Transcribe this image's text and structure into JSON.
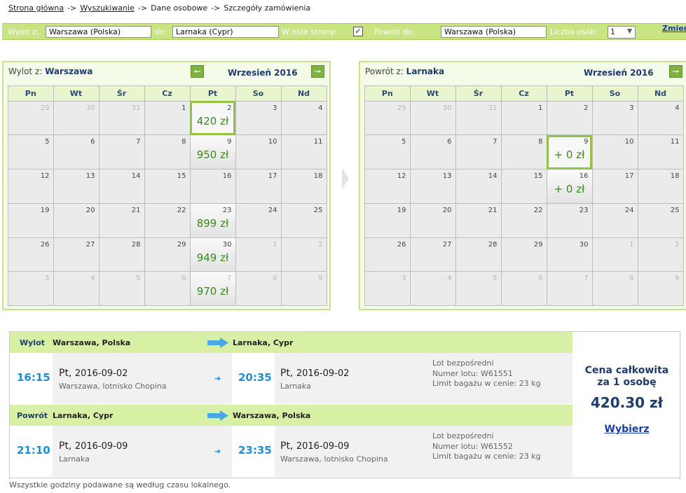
{
  "breadcrumb": [
    {
      "label": "Strona główna",
      "link": true
    },
    {
      "label": "Wyszukiwanie",
      "link": true
    },
    {
      "label": "Dane osobowe",
      "link": false
    },
    {
      "label": "Szczegóły zamówienia",
      "link": false
    }
  ],
  "breadcrumb_sep": "->",
  "search": {
    "from_label": "Wylot z:",
    "from_value": "Warszawa (Polska)",
    "to_label": "do:",
    "to_value": "Larnaka (Cypr)",
    "roundtrip_label": "W obie strony:",
    "roundtrip_checked": "✓",
    "return_label": "Powrót do:",
    "return_value": "Warszawa (Polska)",
    "pax_label": "Liczba osób:",
    "pax_value": "1",
    "change_label": "Zmień"
  },
  "weekdays": [
    "Pn",
    "Wt",
    "Śr",
    "Cz",
    "Pt",
    "So",
    "Nd"
  ],
  "outbound": {
    "title_prefix": "Wylot z:",
    "title_city": "Warszawa",
    "month": "Wrzesień 2016",
    "weeks": [
      [
        {
          "d": "29",
          "o": 1
        },
        {
          "d": "30",
          "o": 1
        },
        {
          "d": "31",
          "o": 1
        },
        {
          "d": "1"
        },
        {
          "d": "2",
          "p": "420 zł",
          "sel": 1
        },
        {
          "d": "3"
        },
        {
          "d": "4"
        }
      ],
      [
        {
          "d": "5"
        },
        {
          "d": "6"
        },
        {
          "d": "7"
        },
        {
          "d": "8"
        },
        {
          "d": "9",
          "p": "950 zł"
        },
        {
          "d": "10"
        },
        {
          "d": "11"
        }
      ],
      [
        {
          "d": "12"
        },
        {
          "d": "13"
        },
        {
          "d": "14"
        },
        {
          "d": "15"
        },
        {
          "d": "16"
        },
        {
          "d": "17"
        },
        {
          "d": "18"
        }
      ],
      [
        {
          "d": "19"
        },
        {
          "d": "20"
        },
        {
          "d": "21"
        },
        {
          "d": "22"
        },
        {
          "d": "23",
          "p": "899 zł"
        },
        {
          "d": "24"
        },
        {
          "d": "25"
        }
      ],
      [
        {
          "d": "26"
        },
        {
          "d": "27"
        },
        {
          "d": "28"
        },
        {
          "d": "29"
        },
        {
          "d": "30",
          "p": "949 zł"
        },
        {
          "d": "1",
          "o": 1
        },
        {
          "d": "2",
          "o": 1
        }
      ],
      [
        {
          "d": "3",
          "o": 1
        },
        {
          "d": "4",
          "o": 1
        },
        {
          "d": "5",
          "o": 1
        },
        {
          "d": "6",
          "o": 1
        },
        {
          "d": "7",
          "o": 1,
          "p": "970 zł"
        },
        {
          "d": "8",
          "o": 1
        },
        {
          "d": "9",
          "o": 1
        }
      ]
    ]
  },
  "inbound": {
    "title_prefix": "Powrót z:",
    "title_city": "Larnaka",
    "month": "Wrzesień 2016",
    "weeks": [
      [
        {
          "d": "29",
          "o": 1
        },
        {
          "d": "30",
          "o": 1
        },
        {
          "d": "31",
          "o": 1
        },
        {
          "d": "1"
        },
        {
          "d": "2"
        },
        {
          "d": "3"
        },
        {
          "d": "4"
        }
      ],
      [
        {
          "d": "5"
        },
        {
          "d": "6"
        },
        {
          "d": "7"
        },
        {
          "d": "8"
        },
        {
          "d": "9",
          "p": "+ 0 zł",
          "sel": 1
        },
        {
          "d": "10"
        },
        {
          "d": "11"
        }
      ],
      [
        {
          "d": "12"
        },
        {
          "d": "13"
        },
        {
          "d": "14"
        },
        {
          "d": "15"
        },
        {
          "d": "16",
          "p": "+ 0 zł"
        },
        {
          "d": "17"
        },
        {
          "d": "18"
        }
      ],
      [
        {
          "d": "19"
        },
        {
          "d": "20"
        },
        {
          "d": "21"
        },
        {
          "d": "22"
        },
        {
          "d": "23"
        },
        {
          "d": "24"
        },
        {
          "d": "25"
        }
      ],
      [
        {
          "d": "26"
        },
        {
          "d": "27"
        },
        {
          "d": "28"
        },
        {
          "d": "29"
        },
        {
          "d": "30"
        },
        {
          "d": "1",
          "o": 1
        },
        {
          "d": "2",
          "o": 1
        }
      ],
      [
        {
          "d": "3",
          "o": 1
        },
        {
          "d": "4",
          "o": 1
        },
        {
          "d": "5",
          "o": 1
        },
        {
          "d": "6",
          "o": 1
        },
        {
          "d": "7",
          "o": 1
        },
        {
          "d": "8",
          "o": 1
        },
        {
          "d": "9",
          "o": 1
        }
      ]
    ]
  },
  "summary": {
    "outbound": {
      "label": "Wylot",
      "from": "Warszawa, Polska",
      "to": "Larnaka, Cypr",
      "dep_time": "16:15",
      "dep_day": "Pt,",
      "dep_date": "2016-09-02",
      "dep_airport": "Warszawa, lotnisko Chopina",
      "arr_time": "20:35",
      "arr_day": "Pt,",
      "arr_date": "2016-09-02",
      "arr_airport": "Larnaka",
      "info1": "Lot bezpośredni",
      "info2": "Numer lotu: W61551",
      "info3": "Limit bagażu w cenie: 23 kg"
    },
    "inbound": {
      "label": "Powrót",
      "from": "Larnaka, Cypr",
      "to": "Warszawa, Polska",
      "dep_time": "21:10",
      "dep_day": "Pt,",
      "dep_date": "2016-09-09",
      "dep_airport": "Larnaka",
      "arr_time": "23:35",
      "arr_day": "Pt,",
      "arr_date": "2016-09-09",
      "arr_airport": "Warszawa, lotnisko Chopina",
      "info1": "Lot bezpośredni",
      "info2": "Numer lotu: W61552",
      "info3": "Limit bagażu w cenie: 23 kg"
    },
    "total_label_1": "Cena całkowita",
    "total_label_2": "za 1 osobę",
    "total_amount": "420.30 zł",
    "select_label": "Wybierz"
  },
  "footnote": "Wszystkie godziny podawane są według czasu lokalnego.",
  "colors": {
    "accent_green": "#c9e484",
    "price_green": "#3a8a1a",
    "time_blue": "#1c8fd8",
    "navy": "#1f3c6e"
  }
}
